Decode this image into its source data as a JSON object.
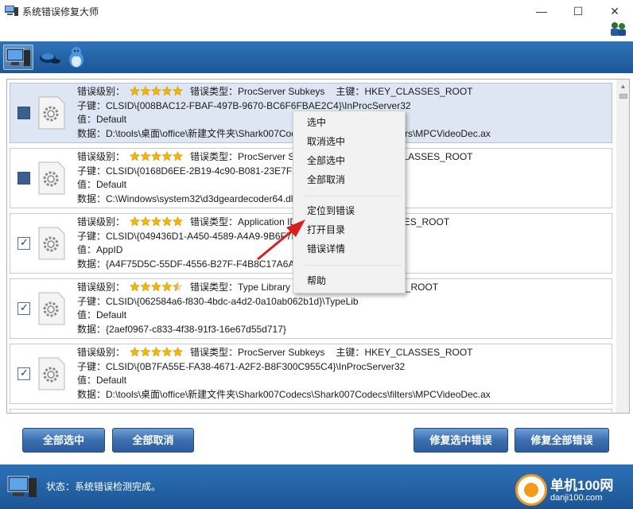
{
  "window": {
    "title": "系统错误修复大师",
    "controls": {
      "minimize": "—",
      "maximize": "☐",
      "close": "✕"
    }
  },
  "toolbar": {
    "items": [
      {
        "icon": "computer-icon",
        "active": true
      },
      {
        "icon": "network-mouse-icon",
        "active": false
      },
      {
        "icon": "qq-penguin-icon",
        "active": false
      }
    ]
  },
  "labels": {
    "level": "错误级别：",
    "type": "错误类型：",
    "key": "主键：",
    "subkey": "子键：",
    "value": "值：",
    "data": "数据："
  },
  "errors": [
    {
      "stars": 5,
      "type": "ProcServer Subkeys",
      "mainkey": "HKEY_CLASSES_ROOT",
      "subkey": "CLSID\\{008BAC12-FBAF-497B-9670-BC6F6FBAE2C4}\\InProcServer32",
      "value": "Default",
      "data": "D:\\tools\\桌面\\office\\新建文件夹\\Shark007Codecs\\Shark007Codecs\\filters\\MPCVideoDec.ax",
      "checked": false,
      "selected": true
    },
    {
      "stars": 5,
      "type": "ProcServer Subkeys",
      "mainkey": "HKEY_CLASSES_ROOT",
      "subkey": "CLSID\\{0168D6EE-2B19-4c90-B081-23E7F2EE6B2B}\\InProcServer32",
      "value": "Default",
      "data": "C:\\Windows\\system32\\d3dgeardecoder64.dll",
      "checked": false,
      "selected": false
    },
    {
      "stars": 5,
      "type": "Application IDs",
      "mainkey": "HKEY_CLASSES_ROOT",
      "subkey": "CLSID\\{049436D1-A450-4589-A4A9-9B6F7F3F5E4B}",
      "value": "AppID",
      "data": "{A4F75D5C-55DF-4556-B27F-F4B8C17A6AE4}",
      "checked": true,
      "selected": false
    },
    {
      "stars": 4.5,
      "type": "Type Library",
      "mainkey": "HKEY_CLASSES_ROOT",
      "subkey": "CLSID\\{062584a6-f830-4bdc-a4d2-0a10ab062b1d}\\TypeLib",
      "value": "Default",
      "data": "{2aef0967-c833-4f38-91f3-16e67d55d717}",
      "checked": true,
      "selected": false
    },
    {
      "stars": 5,
      "type": "ProcServer Subkeys",
      "mainkey": "HKEY_CLASSES_ROOT",
      "subkey": "CLSID\\{0B7FA55E-FA38-4671-A2F2-B8F300C955C4}\\InProcServer32",
      "value": "Default",
      "data": "D:\\tools\\桌面\\office\\新建文件夹\\Shark007Codecs\\Shark007Codecs\\filters\\MPCVideoDec.ax",
      "checked": true,
      "selected": false
    }
  ],
  "context_menu": {
    "items": [
      "选中",
      "取消选中",
      "全部选中",
      "全部取消",
      "定位到错误",
      "打开目录",
      "错误详情",
      "帮助"
    ]
  },
  "buttons": {
    "select_all": "全部选中",
    "deselect_all": "全部取消",
    "fix_selected": "修复选中错误",
    "fix_all": "修复全部错误"
  },
  "status": {
    "text": "状态：系统错误检测完成。"
  },
  "watermark": {
    "line1": "单机100网",
    "line2": "danji100.com"
  },
  "colors": {
    "toolbar_blue": "#1f5fa3",
    "star_gold": "#f2b705",
    "arrow_red": "#d81e1e",
    "watermark_orange": "#f39a1e"
  }
}
